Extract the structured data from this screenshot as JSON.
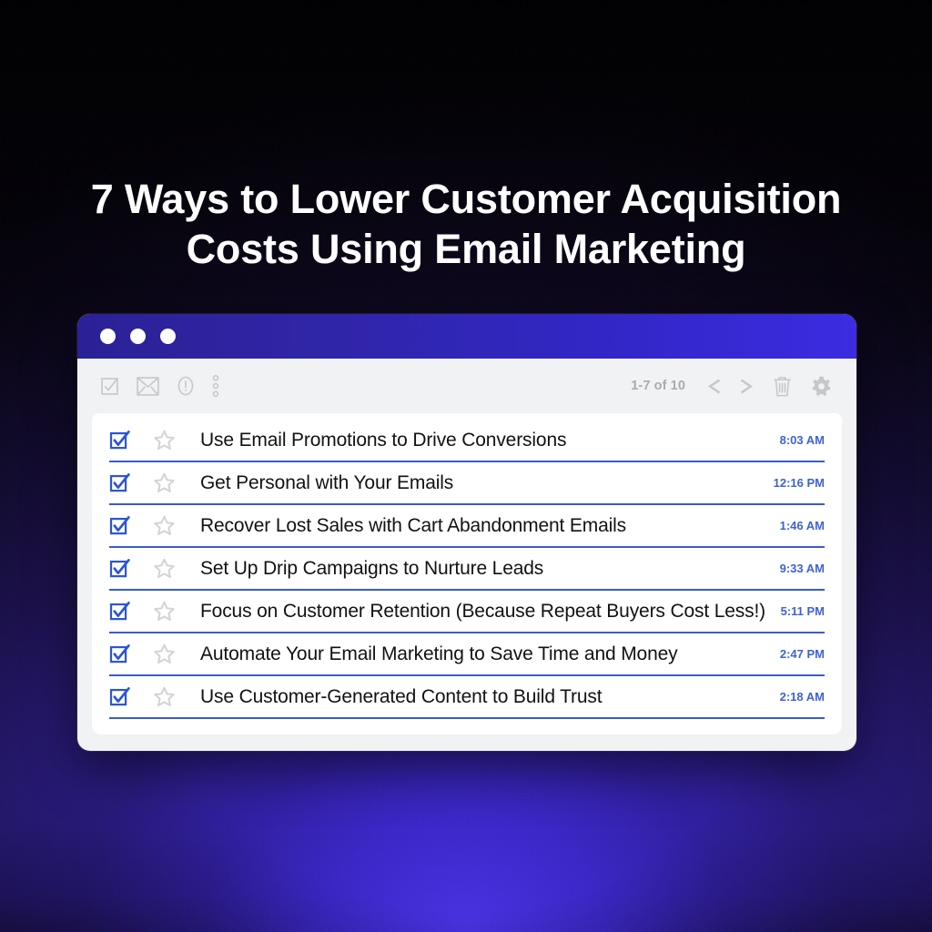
{
  "headline": {
    "line1": "7 Ways to Lower Customer Acquisition",
    "line2": "Costs Using Email Marketing"
  },
  "window": {
    "titlebar": {
      "dots": [
        "window-dot-1",
        "window-dot-2",
        "window-dot-3"
      ]
    },
    "toolbar": {
      "left_icons": [
        {
          "name": "select-all-checkbox-icon",
          "label": "Select all"
        },
        {
          "name": "mark-as-unread-envelope-icon",
          "label": "Mark as unread"
        },
        {
          "name": "report-spam-exclamation-icon",
          "label": "Report spam"
        },
        {
          "name": "more-options-kebab-icon",
          "label": "More options"
        }
      ],
      "page_count": "1-7 of 10",
      "right_icons": [
        {
          "name": "previous-page-chevron-left-icon",
          "label": "Newer"
        },
        {
          "name": "next-page-chevron-right-icon",
          "label": "Older"
        },
        {
          "name": "delete-trash-icon",
          "label": "Delete"
        },
        {
          "name": "settings-gear-icon",
          "label": "Settings"
        }
      ]
    },
    "messages": [
      {
        "subject": "Use Email Promotions to Drive Conversions",
        "time": "8:03 AM",
        "checked": true,
        "starred": false
      },
      {
        "subject": "Get Personal with Your Emails",
        "time": "12:16 PM",
        "checked": true,
        "starred": false
      },
      {
        "subject": "Recover Lost Sales with Cart Abandonment Emails",
        "time": "1:46 AM",
        "checked": true,
        "starred": false
      },
      {
        "subject": "Set Up Drip Campaigns to Nurture Leads",
        "time": "9:33 AM",
        "checked": true,
        "starred": false
      },
      {
        "subject": "Focus on Customer Retention (Because Repeat Buyers Cost Less!)",
        "time": "5:11 PM",
        "checked": true,
        "starred": false
      },
      {
        "subject": "Automate Your Email Marketing to Save Time and Money",
        "time": "2:47 PM",
        "checked": true,
        "starred": false
      },
      {
        "subject": "Use Customer-Generated Content to Build Trust",
        "time": "2:18 AM",
        "checked": true,
        "starred": false
      }
    ]
  },
  "colors": {
    "headline_text": "#ffffff",
    "background_dark": "#050308",
    "background_glow": "#4a34e8",
    "titlebar_gradient_start": "#2b2196",
    "titlebar_gradient_end": "#3b2ce0",
    "toolbar_background": "#f1f2f4",
    "card_background": "#ffffff",
    "checkbox_blue": "#2b55d4",
    "divider_blue": "#3a5ccc",
    "timestamp_blue": "#3e62d6",
    "subject_text": "#111215",
    "toolbar_icon_gray": "#c6c7c9",
    "star_gray": "#d2d3d6"
  }
}
